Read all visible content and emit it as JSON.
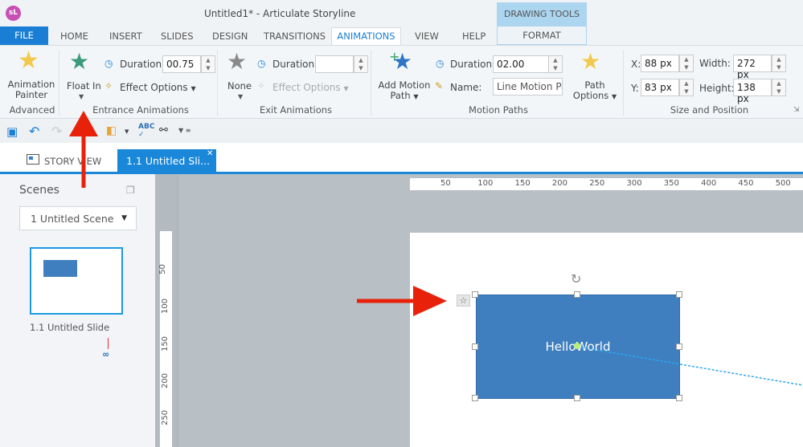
{
  "window": {
    "title": "Untitled1* -  Articulate Storyline",
    "logo": "sL"
  },
  "tabs": {
    "file": "FILE",
    "items": [
      "HOME",
      "INSERT",
      "SLIDES",
      "DESIGN",
      "TRANSITIONS",
      "ANIMATIONS",
      "VIEW",
      "HELP"
    ],
    "active": "ANIMATIONS",
    "context_header": "DRAWING TOOLS",
    "context_tab": "FORMAT"
  },
  "ribbon": {
    "advanced": {
      "button": "Animation Painter",
      "button_l1": "Animation",
      "button_l2": "Painter",
      "group": "Advanced"
    },
    "entrance": {
      "effect": "Float In",
      "duration_label": "Duration:",
      "duration": "00.75",
      "effect_options": "Effect Options",
      "group": "Entrance Animations"
    },
    "exit": {
      "effect": "None",
      "duration_label": "Duration:",
      "duration": "",
      "effect_options": "Effect Options",
      "group": "Exit Animations"
    },
    "motion": {
      "add_l1": "Add Motion",
      "add_l2": "Path",
      "duration_label": "Duration:",
      "duration": "02.00",
      "name_label": "Name:",
      "name": "Line Motion Pat",
      "path_l1": "Path",
      "path_l2": "Options",
      "group": "Motion Paths"
    },
    "size": {
      "x_label": "X:",
      "x": "88 px",
      "y_label": "Y:",
      "y": "83 px",
      "width_label": "Width:",
      "width": "272 px",
      "height_label": "Height:",
      "height": "138 px",
      "group": "Size and Position"
    }
  },
  "doc_tabs": {
    "story_view": "STORY VIEW",
    "active": "1.1 Untitled Sli..."
  },
  "scenes": {
    "title": "Scenes",
    "selected": "1 Untitled Scene",
    "slide_label": "1.1 Untitled Slide"
  },
  "canvas": {
    "shape_text": "HelloWorld",
    "h_ruler": [
      "50",
      "100",
      "150",
      "200",
      "250",
      "300",
      "350",
      "400",
      "450",
      "500"
    ],
    "v_ruler": [
      "50",
      "100",
      "150",
      "200",
      "250"
    ]
  },
  "colors": {
    "accent": "#1a7fd4",
    "shape": "#3f7fbf",
    "annotation": "#e8220a"
  }
}
